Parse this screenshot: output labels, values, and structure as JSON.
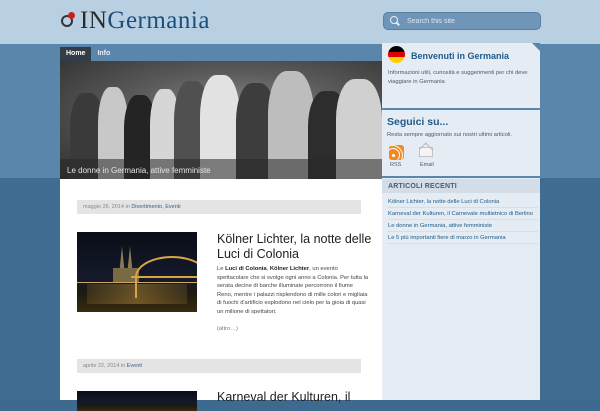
{
  "site": {
    "logo_prefix": "IN",
    "logo_main": "Germania"
  },
  "search": {
    "placeholder": "Search this site"
  },
  "nav": {
    "items": [
      "Home",
      "Info"
    ]
  },
  "hero": {
    "caption": "Le donne in Germania, attive femministe"
  },
  "posts": [
    {
      "date": "maggio 26, 2014",
      "in": "in",
      "categories": "Divertimento, Eventi",
      "title": "Kölner Lichter, la notte delle Luci di Colonia",
      "excerpt_lead": "Le ",
      "excerpt_b1": "Luci di Colonia",
      "excerpt_sep": ", ",
      "excerpt_b2": "Kölner Lichter",
      "excerpt_rest": ", un evento spettacolare che si svolge ogni anno a Colonia. Per tutta la serata decine di barche illuminate percorrono il fiume Reno, mentre i palazzi risplendono di mille colori e migliaia di fuochi d'artificio esplodono nel cielo per la gioia di quasi un milione di spettatori.",
      "more": "(altro…)"
    },
    {
      "date": "aprile 22, 2014",
      "in": "in",
      "categories": "Eventi",
      "title": "Karneval der Kulturen, il"
    }
  ],
  "sidebar": {
    "welcome_title": "Benvenuti in Germania",
    "welcome_text": "Informazioni utili, curiosità e suggerimenti per chi deve viaggiare in Germania",
    "follow_title": "Seguici su...",
    "follow_text": "Resta sempre aggiornato sui nostri ultimi articoli.",
    "rss_label": "RSS",
    "email_label": "Email",
    "recent_title": "ARTICOLI RECENTI",
    "recent_items": [
      "Kölner Lichter, la notte delle Luci di Colonia",
      "Karneval der Kulturen, il Carnevale multietnico di Berlino",
      "Le donne in Germania, attive femministe",
      "Le 5 più importanti fiere di marzo in Germania"
    ]
  },
  "colors": {
    "accent": "#1e5a8a",
    "logo_dot": "#c5221f",
    "rss": "#f18a24",
    "flag": [
      "#000000",
      "#dd0000",
      "#ffce00"
    ]
  }
}
